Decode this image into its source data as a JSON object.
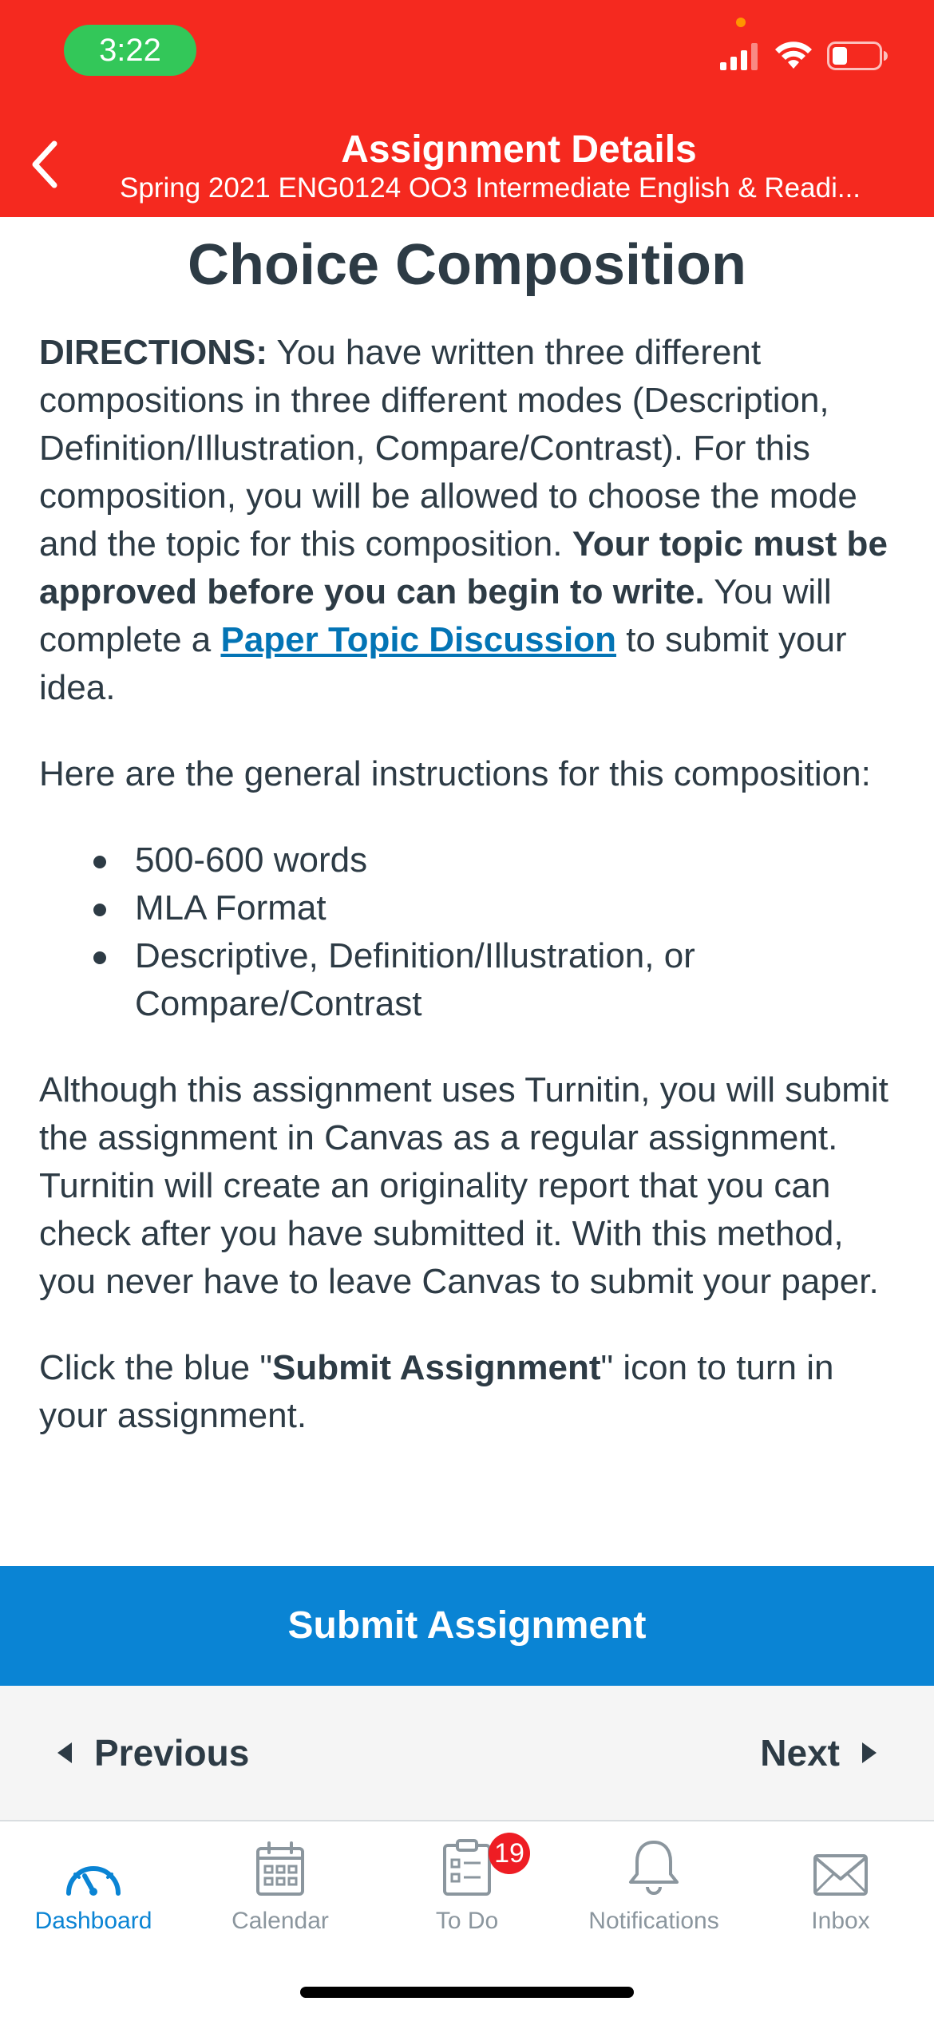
{
  "status_bar": {
    "time": "3:22",
    "icons": [
      "cellular-signal-icon",
      "wifi-icon",
      "battery-icon"
    ]
  },
  "nav": {
    "title": "Assignment Details",
    "subtitle": "Spring 2021 ENG0124 OO3 Intermediate English & Readi...",
    "back_icon": "chevron-left-icon"
  },
  "content": {
    "title": "Choice Composition",
    "p1": {
      "lead": "DIRECTIONS:",
      "text1": " You have written three different compositions in three different modes (Description, Definition/Illustration, Compare/Contrast). For this composition, you will be allowed to choose the mode and the topic for this composition. ",
      "bold": "Your topic must be approved before you can begin to write.",
      "text2": " You will complete a ",
      "link": "Paper Topic Discussion",
      "text3": " to submit your idea."
    },
    "p2": "Here are the general instructions for this composition:",
    "bullets": [
      "500-600 words",
      "MLA Format",
      "Descriptive, Definition/Illustration, or Compare/Contrast"
    ],
    "p3": "Although this assignment uses Turnitin, you will submit the assignment in Canvas as a regular assignment. Turnitin will create an originality report that you can check after you have submitted it. With this method, you never have to leave Canvas to submit your paper.",
    "p4": {
      "text1": "Click the blue \"",
      "bold": "Submit Assignment",
      "text2": "\" icon to turn in your assignment."
    }
  },
  "submit": {
    "label": "Submit Assignment"
  },
  "pager": {
    "previous": "Previous",
    "next": "Next"
  },
  "tabbar": {
    "tabs": [
      {
        "label": "Dashboard",
        "icon": "dashboard-gauge-icon",
        "active": true
      },
      {
        "label": "Calendar",
        "icon": "calendar-icon",
        "active": false
      },
      {
        "label": "To Do",
        "icon": "todo-clipboard-icon",
        "active": false,
        "badge": "19"
      },
      {
        "label": "Notifications",
        "icon": "bell-icon",
        "active": false
      },
      {
        "label": "Inbox",
        "icon": "envelope-icon",
        "active": false
      }
    ]
  },
  "colors": {
    "brand_red": "#f5291f",
    "accent_blue": "#0a84d4",
    "link_blue": "#0374b5",
    "text": "#2d3b45",
    "tab_inactive": "#8b969e",
    "badge_red": "#ee1d24"
  }
}
